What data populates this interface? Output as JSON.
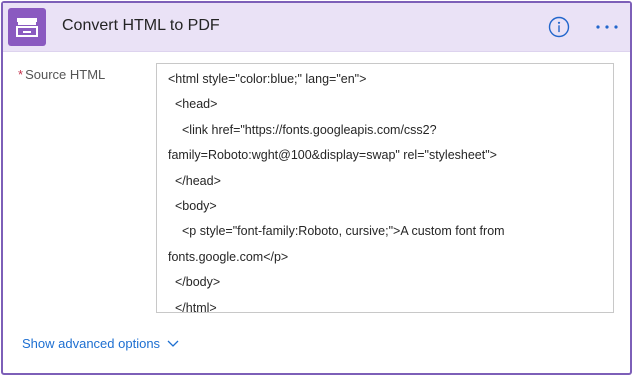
{
  "action": {
    "title": "Convert HTML to PDF",
    "app_icon": "drawer-tray-icon",
    "brand_color": "#8a5ac0",
    "header_bg": "#eae2f6"
  },
  "fields": {
    "source_html": {
      "label": "Source HTML",
      "required_marker": "*",
      "lines": [
        "<html style=\"color:blue;\" lang=\"en\">",
        "  <head>",
        "    <link href=\"https://fonts.googleapis.com/css2?",
        "family=Roboto:wght@100&display=swap\" rel=\"stylesheet\">",
        "  </head>",
        "  <body>",
        "    <p style=\"font-family:Roboto, cursive;\">A custom font from",
        "fonts.google.com</p>",
        "  </body>",
        "  </html>"
      ]
    }
  },
  "footer": {
    "advanced_label": "Show advanced options"
  },
  "icons": {
    "info": "info-icon",
    "more": "more-options-icon",
    "chevron": "chevron-down-icon"
  }
}
